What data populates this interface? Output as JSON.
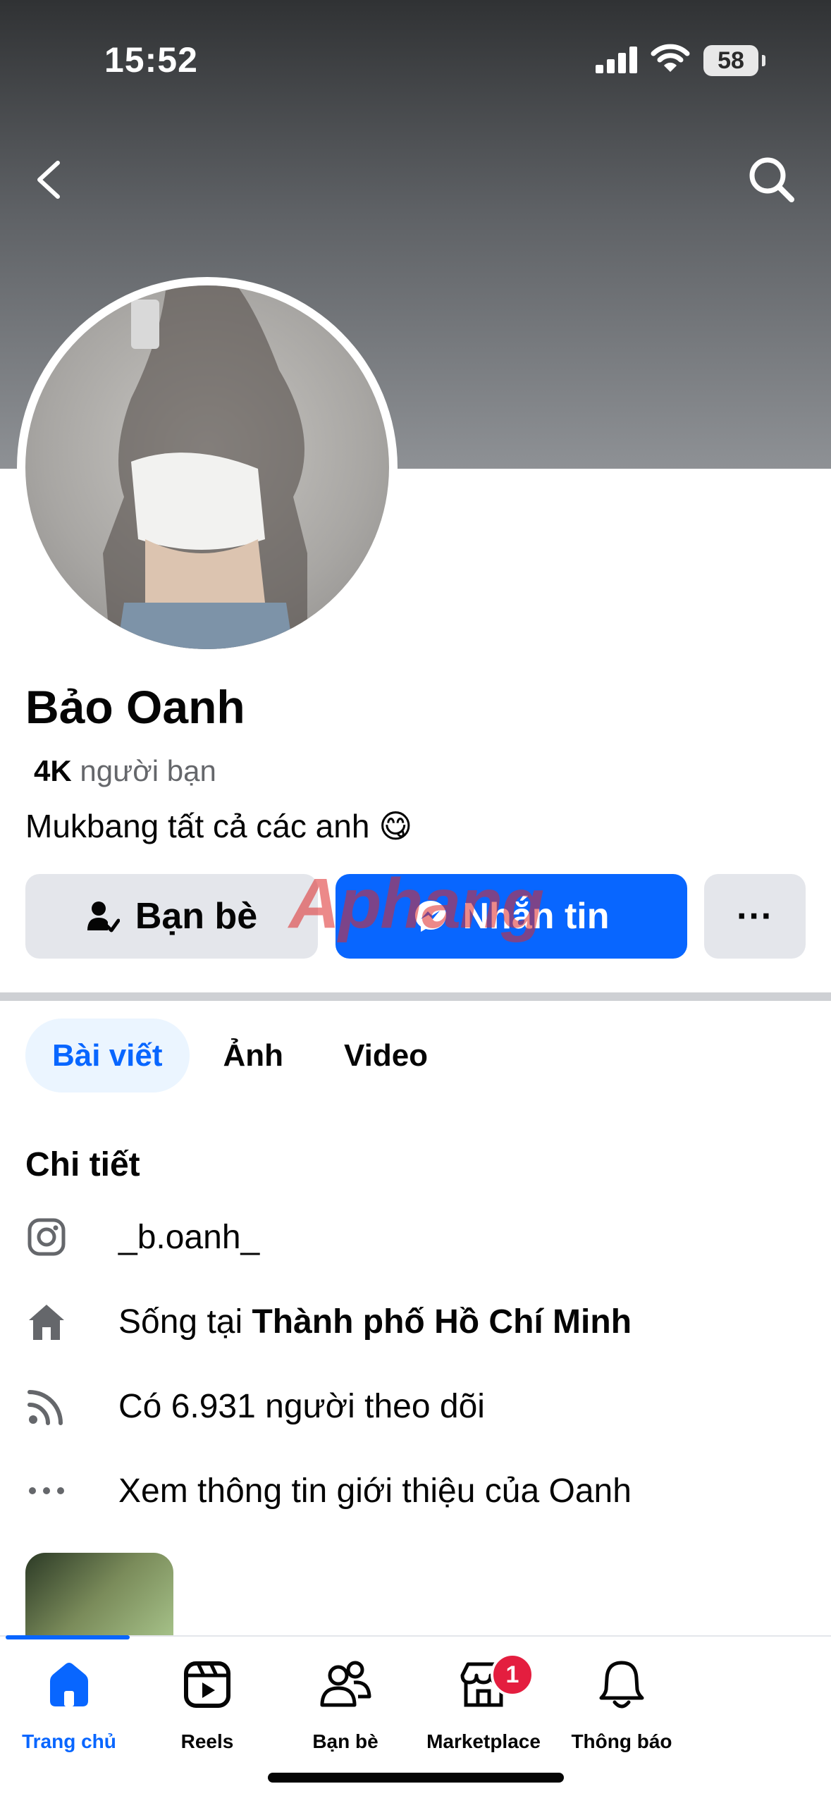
{
  "status_bar": {
    "time": "15:52",
    "battery": "58"
  },
  "profile": {
    "name": "Bảo Oanh",
    "friends_count": "4K",
    "friends_label": "người bạn",
    "bio": "Mukbang tất cả các anh 😋"
  },
  "actions": {
    "friends_button": "Bạn bè",
    "message_button": "Nhắn tin",
    "more_button": "···"
  },
  "watermark": "Aphang",
  "tabs": [
    "Bài viết",
    "Ảnh",
    "Video"
  ],
  "details": {
    "title": "Chi tiết",
    "instagram": "_b.oanh_",
    "lives_prefix": "Sống tại ",
    "lives_city": "Thành phố Hồ Chí Minh",
    "followers": "Có 6.931 người theo dõi",
    "see_about": "Xem thông tin giới thiệu của Oanh"
  },
  "bottom_nav": [
    {
      "label": "Trang chủ",
      "icon": "home-icon"
    },
    {
      "label": "Reels",
      "icon": "reels-icon"
    },
    {
      "label": "Bạn bè",
      "icon": "friends-icon"
    },
    {
      "label": "Marketplace",
      "icon": "marketplace-icon",
      "badge": "1"
    },
    {
      "label": "Thông báo",
      "icon": "bell-icon"
    }
  ],
  "colors": {
    "accent": "#0866ff",
    "badge": "#e41e3f",
    "button_gray": "#e4e6eb"
  }
}
